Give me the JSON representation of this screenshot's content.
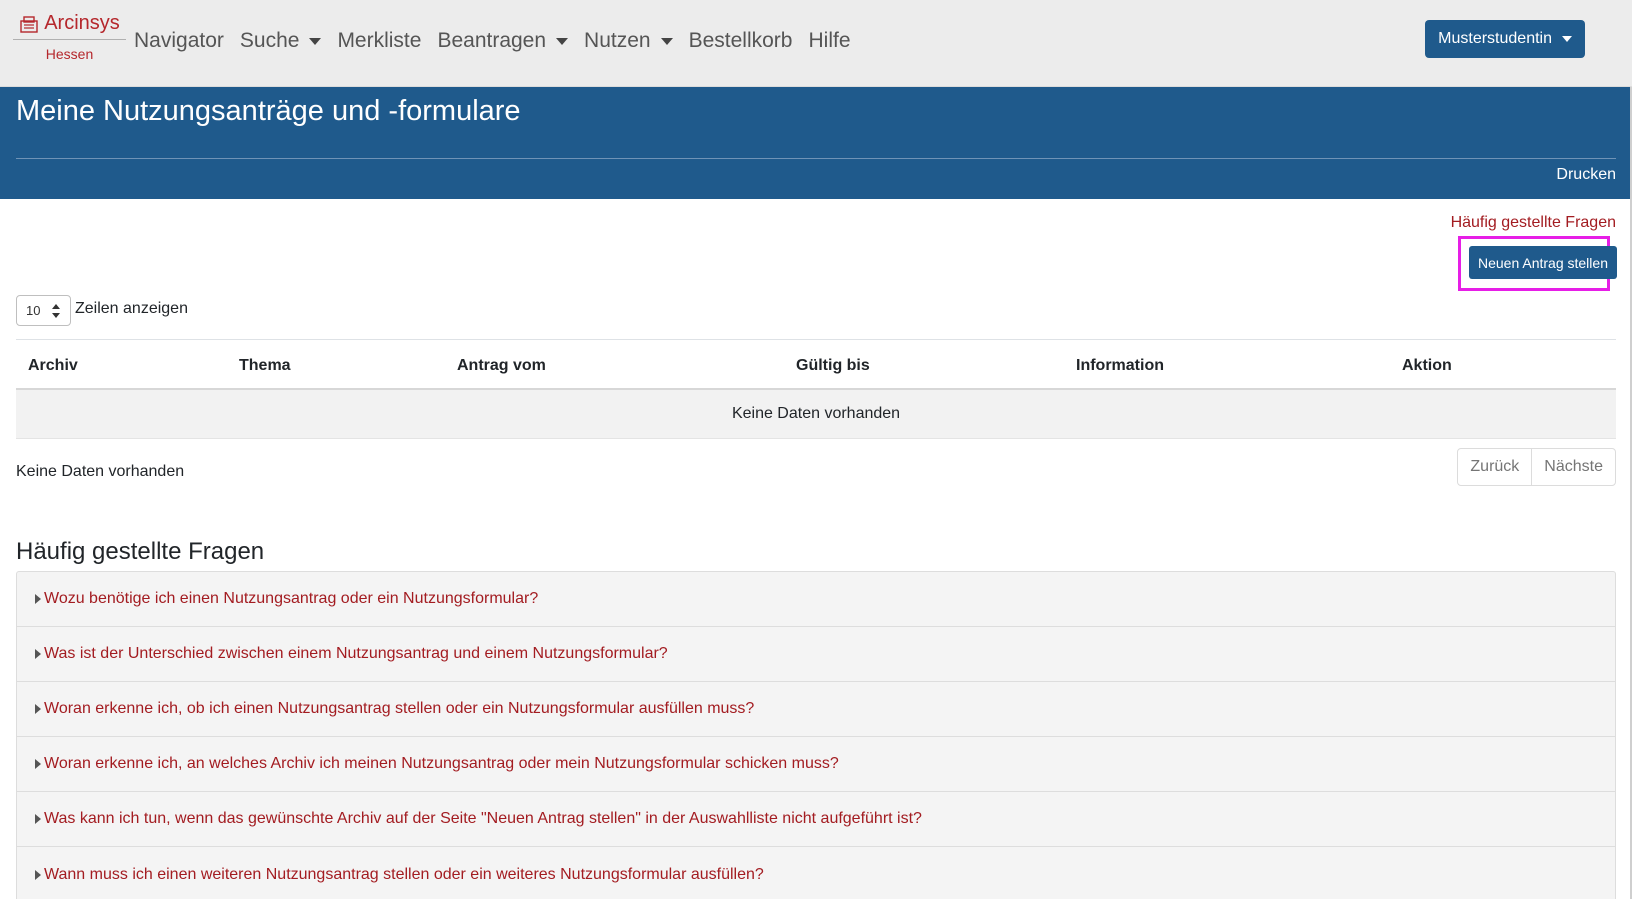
{
  "brand": {
    "name": "Arcinsys",
    "sub": "Hessen",
    "accent": "#b5272c"
  },
  "nav": {
    "items": [
      {
        "label": "Navigator",
        "dropdown": false
      },
      {
        "label": "Suche",
        "dropdown": true
      },
      {
        "label": "Merkliste",
        "dropdown": false
      },
      {
        "label": "Beantragen",
        "dropdown": true
      },
      {
        "label": "Nutzen",
        "dropdown": true
      },
      {
        "label": "Bestellkorb",
        "dropdown": false
      },
      {
        "label": "Hilfe",
        "dropdown": false
      }
    ],
    "user": "Musterstudentin"
  },
  "header": {
    "title": "Meine Nutzungsanträge und -formulare",
    "print": "Drucken",
    "color": "#1f5a8c"
  },
  "content": {
    "faq_link": "Häufig gestellte Fragen",
    "new_request": "Neuen Antrag stellen",
    "length_value": "10",
    "length_label": "Zeilen anzeigen",
    "columns": [
      "Archiv",
      "Thema",
      "Antrag vom",
      "Gültig bis",
      "Information",
      "Aktion"
    ],
    "empty": "Keine Daten vorhanden",
    "info": "Keine Daten vorhanden",
    "prev": "Zurück",
    "next": "Nächste"
  },
  "faq": {
    "heading": "Häufig gestellte Fragen",
    "items": [
      "Wozu benötige ich einen Nutzungsantrag oder ein Nutzungsformular?",
      "Was ist der Unterschied zwischen einem Nutzungsantrag und einem Nutzungsformular?",
      "Woran erkenne ich, ob ich einen Nutzungsantrag stellen oder ein Nutzungsformular ausfüllen muss?",
      "Woran erkenne ich, an welches Archiv ich meinen Nutzungsantrag oder mein Nutzungsformular schicken muss?",
      "Was kann ich tun, wenn das gewünschte Archiv auf der Seite \"Neuen Antrag stellen\" in der Auswahlliste nicht aufgeführt ist?",
      "Wann muss ich einen weiteren Nutzungsantrag stellen oder ein weiteres Nutzungsformular ausfüllen?"
    ]
  }
}
